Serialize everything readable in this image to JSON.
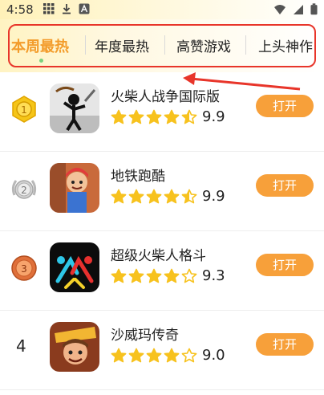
{
  "status_bar": {
    "time": "4:58"
  },
  "tabs": [
    {
      "label": "本周最热",
      "active": true
    },
    {
      "label": "年度最热",
      "active": false
    },
    {
      "label": "高赞游戏",
      "active": false
    },
    {
      "label": "上头神作",
      "active": false
    }
  ],
  "games": [
    {
      "rank": "1",
      "name": "火柴人战争国际版",
      "rating": "9.9",
      "stars": 4.5,
      "button": "打开"
    },
    {
      "rank": "2",
      "name": "地铁跑酷",
      "rating": "9.9",
      "stars": 4.5,
      "button": "打开"
    },
    {
      "rank": "3",
      "name": "超级火柴人格斗",
      "rating": "9.3",
      "stars": 4,
      "button": "打开"
    },
    {
      "rank": "4",
      "name": "沙威玛传奇",
      "rating": "9.0",
      "stars": 4,
      "button": "打开"
    }
  ],
  "colors": {
    "accent": "#f39c2b",
    "button": "#f7a03a",
    "star": "#f7c21e",
    "annotation": "#e8352a"
  }
}
